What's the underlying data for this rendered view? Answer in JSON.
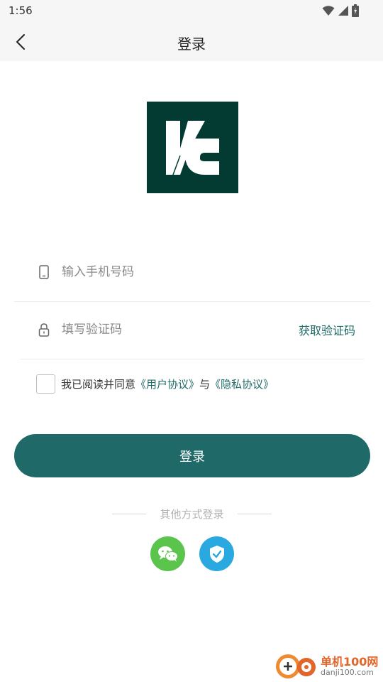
{
  "status_bar": {
    "time": "1:56"
  },
  "app_bar": {
    "title": "登录",
    "back_icon": "chevron-left-icon"
  },
  "logo": {
    "brand_color": "#033a32"
  },
  "phone_field": {
    "placeholder": "输入手机号码",
    "value": "",
    "icon": "phone-icon"
  },
  "code_field": {
    "placeholder": "填写验证码",
    "value": "",
    "icon": "lock-icon",
    "get_code_label": "获取验证码"
  },
  "agreement": {
    "checked": false,
    "prefix": "我已阅读并同意",
    "user_agreement": "《用户协议》",
    "conjunction": "与",
    "privacy_policy": "《隐私协议》"
  },
  "login_button": {
    "label": "登录",
    "color": "#1f6a68"
  },
  "other_login": {
    "label": "其他方式登录",
    "options": [
      {
        "icon": "wechat-icon",
        "color": "#5bc44d"
      },
      {
        "icon": "shield-check-icon",
        "color": "#2aa9e0"
      }
    ]
  },
  "watermark": {
    "main": "单机100网",
    "sub": "danji100.com"
  },
  "colors": {
    "accent": "#1e6a67",
    "background": "#ffffff",
    "bar_background": "#f6f6f6"
  }
}
